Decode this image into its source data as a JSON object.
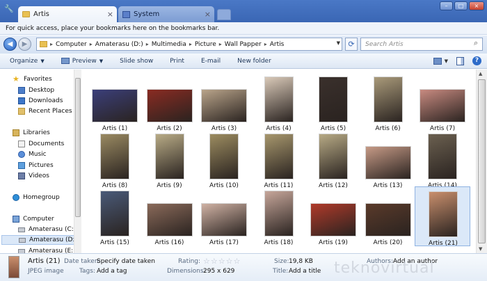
{
  "tabs": [
    {
      "label": "Artis",
      "active": true
    },
    {
      "label": "System",
      "active": false
    }
  ],
  "bookmarks_bar": "For quick access, place your bookmarks here on the bookmarks bar.",
  "address": {
    "crumbs": [
      "Computer",
      "Amaterasu (D:)",
      "Multimedia",
      "Picture",
      "Wall Papper",
      "Artis"
    ]
  },
  "search": {
    "placeholder": "Search Artis"
  },
  "toolbar": {
    "organize": "Organize",
    "preview": "Preview",
    "slideshow": "Slide show",
    "print": "Print",
    "email": "E-mail",
    "new_folder": "New folder"
  },
  "sidebar": {
    "favorites": "Favorites",
    "desktop": "Desktop",
    "downloads": "Downloads",
    "recent": "Recent Places",
    "libraries": "Libraries",
    "documents": "Documents",
    "music": "Music",
    "pictures": "Pictures",
    "videos": "Videos",
    "homegroup": "Homegroup",
    "computer": "Computer",
    "drive_c": "Amaterasu (C:)",
    "drive_d": "Amaterasu (D:)",
    "drive_e": "Amaterasu (E:)"
  },
  "files": [
    {
      "name": "Artis (1)",
      "color": "#3b3f7a"
    },
    {
      "name": "Artis (2)",
      "color": "#8a2b22"
    },
    {
      "name": "Artis (3)",
      "color": "#b9a48a"
    },
    {
      "name": "Artis (4)",
      "color": "#d9c9b8"
    },
    {
      "name": "Artis (5)",
      "color": "#3a302c"
    },
    {
      "name": "Artis (6)",
      "color": "#a99a7a"
    },
    {
      "name": "Artis (7)",
      "color": "#c88a80"
    },
    {
      "name": "Artis (8)",
      "color": "#9a8a62"
    },
    {
      "name": "Artis (9)",
      "color": "#b8ab86"
    },
    {
      "name": "Artis (10)",
      "color": "#9c8c60"
    },
    {
      "name": "Artis (11)",
      "color": "#a7976d"
    },
    {
      "name": "Artis (12)",
      "color": "#b7aa85"
    },
    {
      "name": "Artis (13)",
      "color": "#c69a86"
    },
    {
      "name": "Artis (14)",
      "color": "#6b6050"
    },
    {
      "name": "Artis (15)",
      "color": "#4a5a78"
    },
    {
      "name": "Artis (16)",
      "color": "#8a6a5a"
    },
    {
      "name": "Artis (17)",
      "color": "#d0b2a4"
    },
    {
      "name": "Artis (18)",
      "color": "#c6a69a"
    },
    {
      "name": "Artis (19)",
      "color": "#b03a2a"
    },
    {
      "name": "Artis (20)",
      "color": "#5a3a2a"
    },
    {
      "name": "Artis (21)",
      "color": "#c98f6d"
    }
  ],
  "details": {
    "name": "Artis (21)",
    "type": "JPEG image",
    "date_taken_key": "Date taken:",
    "date_taken_val": "Specify date taken",
    "tags_key": "Tags:",
    "tags_val": "Add a tag",
    "rating_key": "Rating:",
    "rating_stars": "☆☆☆☆☆",
    "dimensions_key": "Dimensions:",
    "dimensions_val": "295 x 629",
    "size_key": "Size:",
    "size_val": "19,8 KB",
    "title_key": "Title:",
    "title_val": "Add a title",
    "authors_key": "Authors:",
    "authors_val": "Add an author"
  },
  "watermark": "teknovirtual"
}
